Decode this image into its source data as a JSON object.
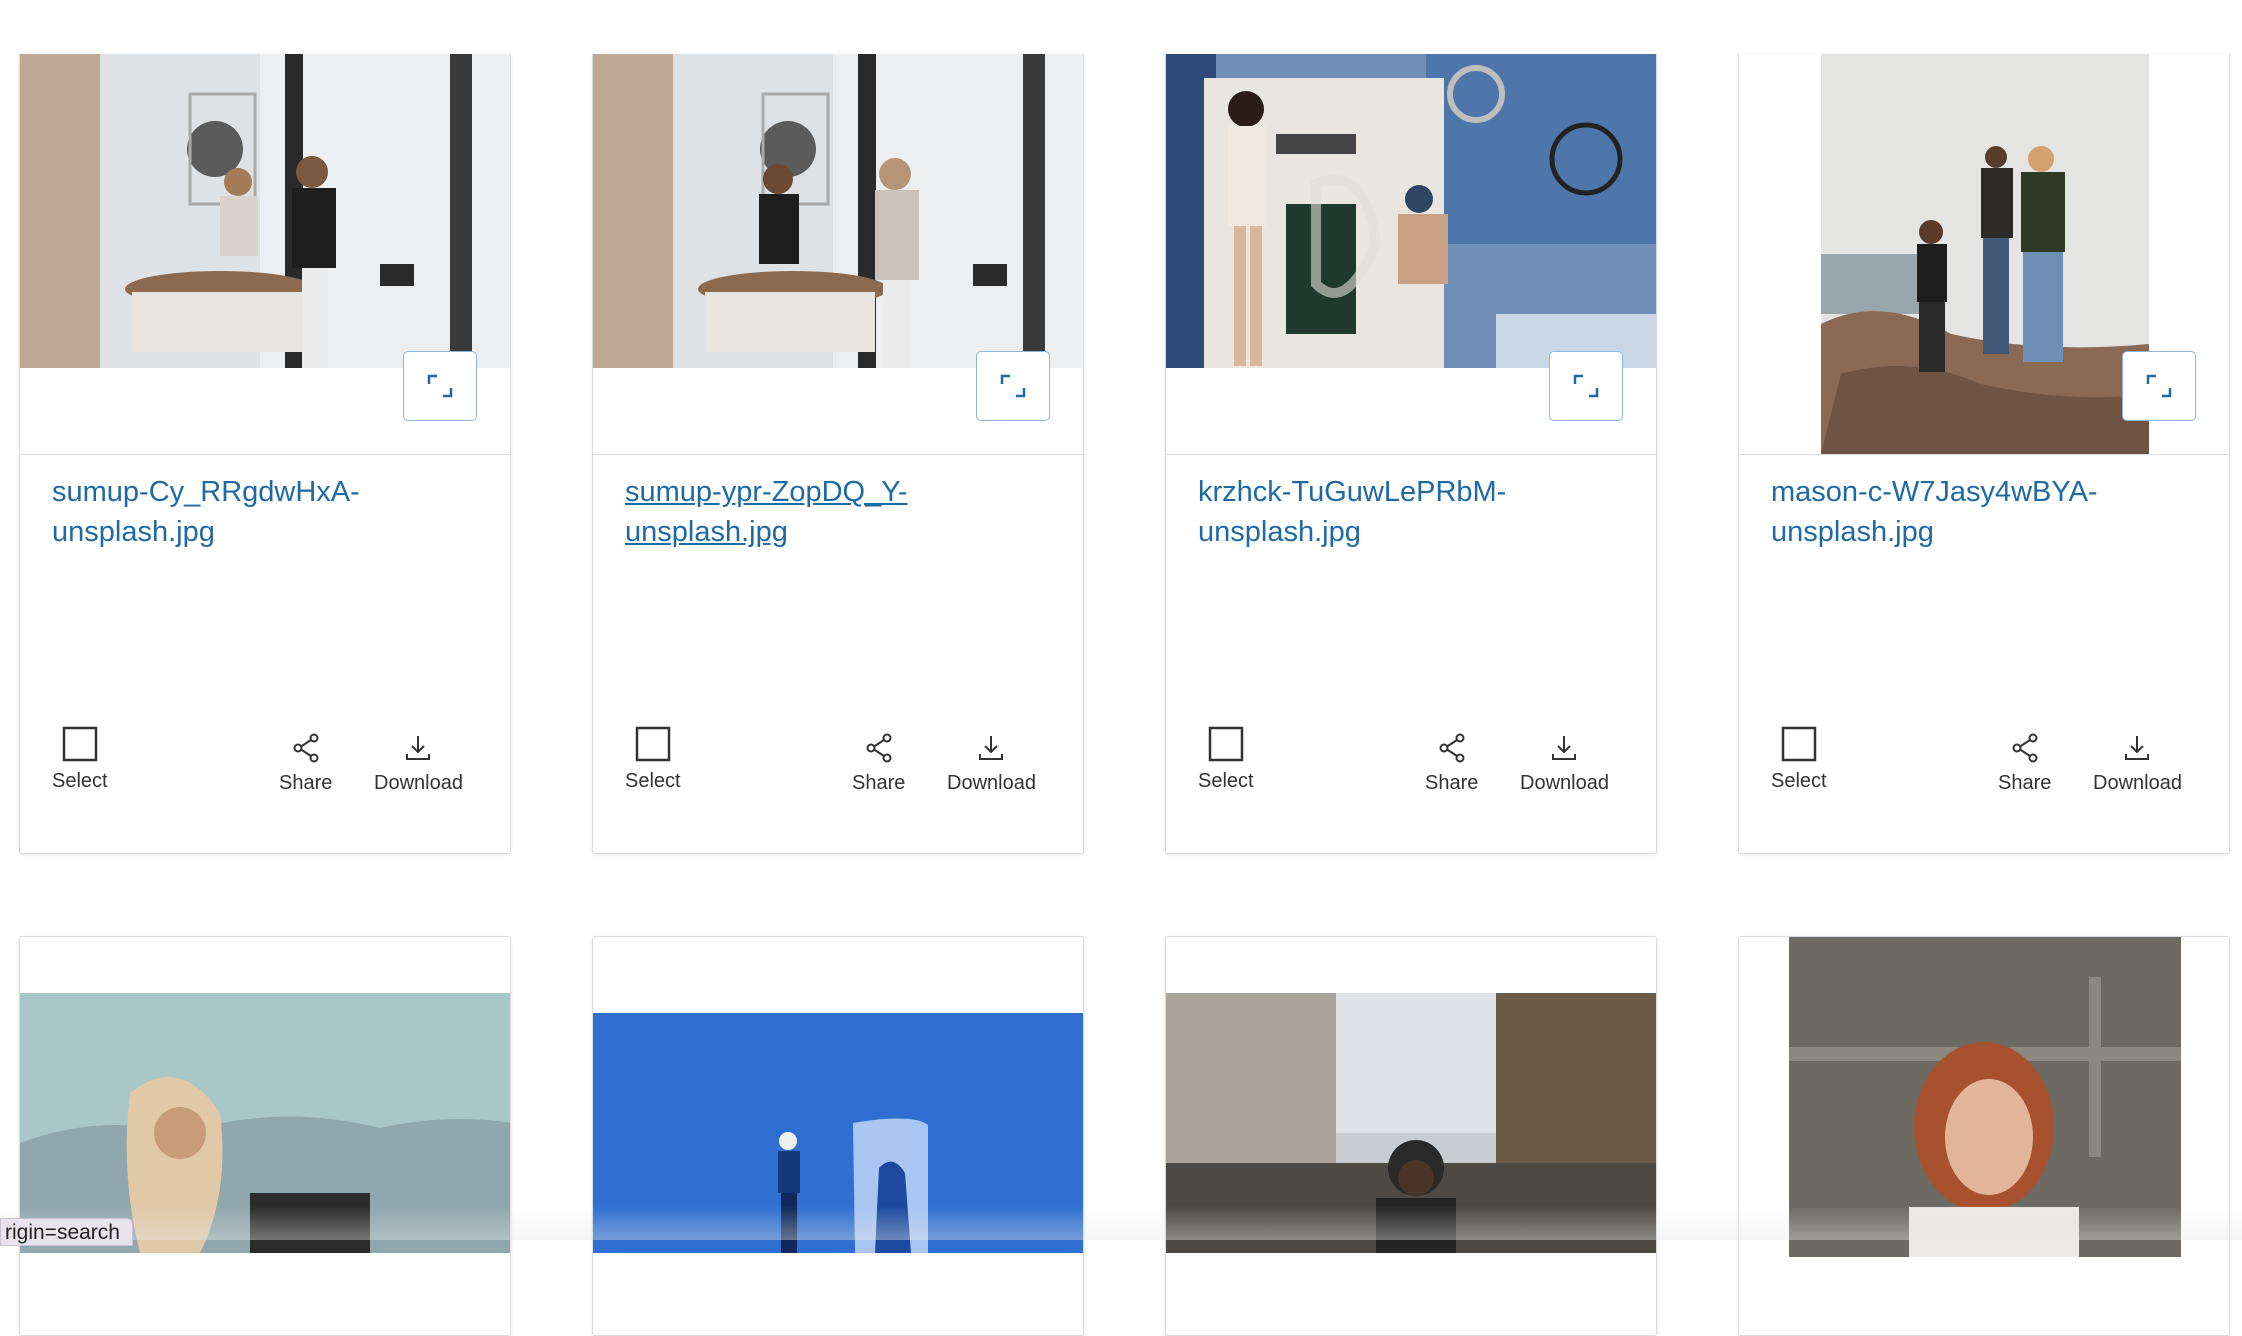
{
  "gallery": {
    "row1": [
      {
        "filename": "sumup-Cy_RRgdwHxA-unsplash.jpg",
        "filename_line1": "sumup-Cy_RRgdwHxA-",
        "filename_line2": "unsplash.jpg",
        "select_label": "Select",
        "share_label": "Share",
        "download_label": "Download"
      },
      {
        "filename": "sumup-ypr-ZopDQ_Y-unsplash.jpg",
        "filename_line1": "sumup-ypr-ZopDQ_Y-",
        "filename_line2": "unsplash.jpg",
        "select_label": "Select",
        "share_label": "Share",
        "download_label": "Download"
      },
      {
        "filename": "krzhck-TuGuwLePRbM-unsplash.jpg",
        "filename_line1": "krzhck-TuGuwLePRbM-",
        "filename_line2": "unsplash.jpg",
        "select_label": "Select",
        "share_label": "Share",
        "download_label": "Download"
      },
      {
        "filename": "mason-c-W7Jasy4wBYA-unsplash.jpg",
        "filename_line1": "mason-c-W7Jasy4wBYA-",
        "filename_line2": "unsplash.jpg",
        "select_label": "Select",
        "share_label": "Share",
        "download_label": "Download"
      }
    ]
  },
  "status_bar": {
    "text": "rigin=search"
  },
  "colors": {
    "link": "#1f6aa5",
    "border": "#d9dde2",
    "expand_border": "#8fb6d8"
  },
  "icons": [
    "expand-icon",
    "checkbox-icon",
    "share-icon",
    "download-icon"
  ]
}
